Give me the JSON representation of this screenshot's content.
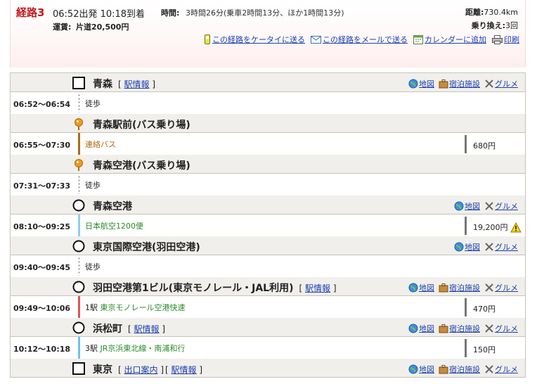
{
  "header": {
    "route_no": "経路3",
    "times": "06:52出発 10:18到着",
    "duration_label": "時間:",
    "duration_value": "3時間26分(乗車2時間13分、ほか1時間13分)",
    "fare_label": "運賃:",
    "fare_value": "片道20,500円",
    "distance_label": "距離:",
    "distance_value": "730.4km",
    "transfers_label": "乗り換え:",
    "transfers_value": "3回",
    "actions": {
      "mobile": "この経路をケータイに送る",
      "mail": "この経路をメールで送る",
      "calendar": "カレンダーに追加",
      "print": "印刷"
    }
  },
  "links": {
    "station_info": "駅情報",
    "exit_info": "出口案内",
    "map": "地図",
    "lodging": "宿泊施設",
    "gourmet": "グルメ"
  },
  "stations": [
    {
      "name": "青森"
    },
    {
      "name": "青森駅前(バス乗り場)"
    },
    {
      "name": "青森空港(バス乗り場)"
    },
    {
      "name": "青森空港"
    },
    {
      "name": "東京国際空港(羽田空港)"
    },
    {
      "name": "羽田空港第1ビル(東京モノレール・JAL利用)"
    },
    {
      "name": "浜松町"
    },
    {
      "name": "東京"
    }
  ],
  "segments": [
    {
      "time": "06:52～06:54",
      "mode": "徒歩",
      "fare": ""
    },
    {
      "time": "06:55～07:30",
      "mode": "連絡バス",
      "fare": "680円",
      "color": "#b06a16"
    },
    {
      "time": "07:31～07:33",
      "mode": "徒歩",
      "fare": ""
    },
    {
      "time": "08:10～09:25",
      "mode": "日本航空1200便",
      "fare": "19,200円",
      "color": "#8ecdf0"
    },
    {
      "time": "09:40～09:45",
      "mode": "徒歩",
      "fare": ""
    },
    {
      "time": "09:49～10:06",
      "stops": "1駅",
      "mode": "東京モノレール空港快速",
      "fare": "470円",
      "color": "#e05454"
    },
    {
      "time": "10:12～10:18",
      "stops": "3駅",
      "mode": "JR京浜東北線・南浦和行",
      "fare": "150円",
      "color": "#6cc3f0"
    }
  ],
  "colors": {
    "route_accent": "#c4161c",
    "link": "#1a3fb0",
    "station_bar": "#f1efeb",
    "bus_pin": "#ef9a1a",
    "mode_green": "#2a8a2a",
    "bus_text": "#b06a16"
  }
}
